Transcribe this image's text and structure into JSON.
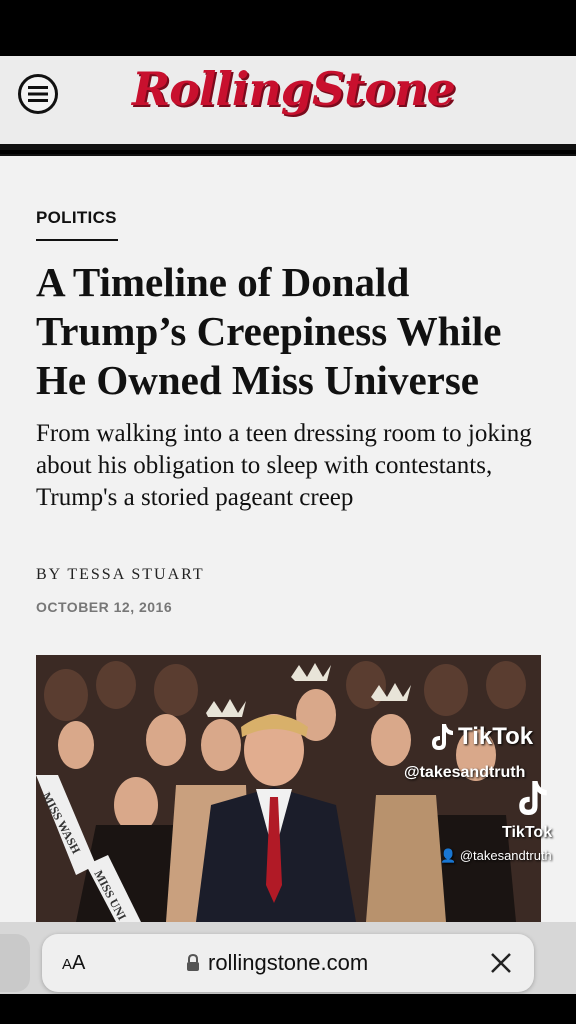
{
  "header": {
    "logo_text": "RollingStone",
    "menu_icon": "menu-icon"
  },
  "article": {
    "section": "POLITICS",
    "headline": "A Timeline of Donald Trump’s Creepiness While He Owned Miss Universe",
    "dek": "From walking into a teen dressing room to joking about his obligation to sleep with contestants, Trump's a storied pageant creep",
    "byline": "BY TESSA STUART",
    "date": "OCTOBER 12, 2016",
    "photo_sash_1": "MISS WASH",
    "photo_sash_2": "MISS UNI"
  },
  "watermark": {
    "brand": "TikTok",
    "handle": "@takesandtruth",
    "brand_small": "TikTok",
    "handle_small": "@takesandtruth"
  },
  "browser": {
    "text_size_label_small": "A",
    "text_size_label_large": "A",
    "url": "rollingstone.com",
    "lock_icon": "lock-icon",
    "close_icon": "close-icon"
  },
  "colors": {
    "brand_red": "#c8102e",
    "page_bg": "#f2f2f2",
    "date_gray": "#777777"
  }
}
